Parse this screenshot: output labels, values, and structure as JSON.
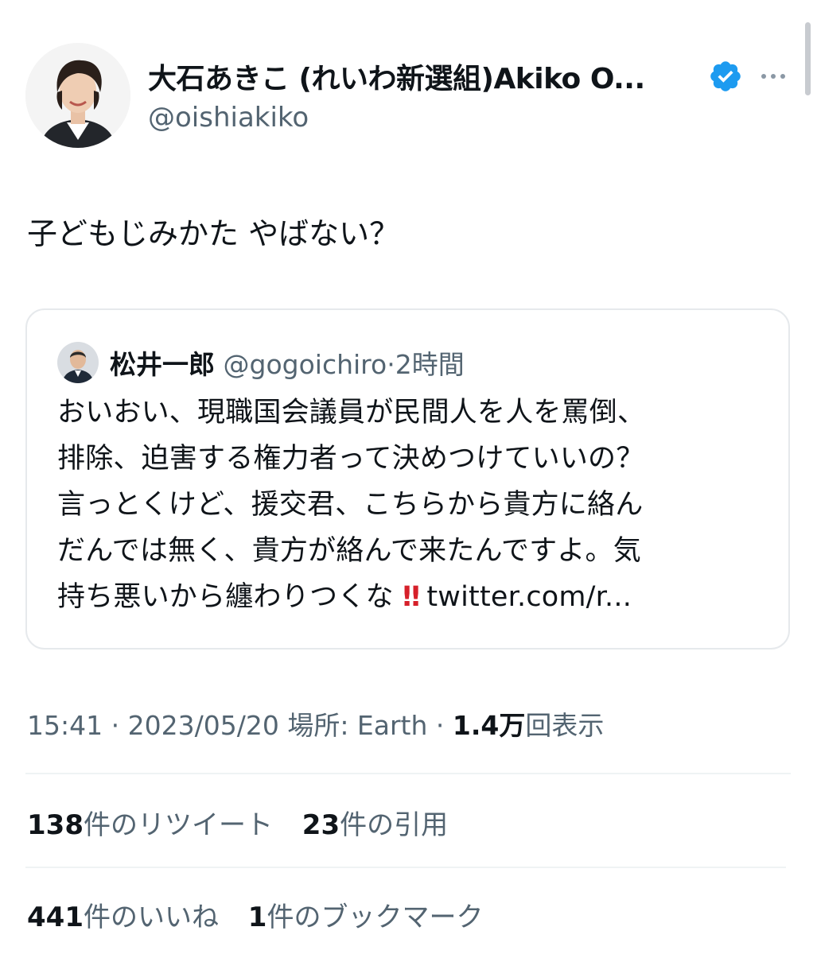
{
  "author": {
    "name": "大石あきこ (れいわ新選組)Akiko O...",
    "handle": "@oishiakiko",
    "verified_color": "#1d9bf0"
  },
  "tweet": {
    "text": "子どもじみかた やばない？"
  },
  "quote": {
    "name": "松井一郎",
    "handle": "@gogoichiro",
    "separator": "·",
    "time": "2時間",
    "lines": [
      "おいおい、現職国会議員が民間人を人を罵倒、",
      "排除、迫害する権力者って決めつけていいの？",
      "言っとくけど、援交君、こちらから貴方に絡ん",
      "だんでは無く、貴方が絡んで来たんですよ。気"
    ],
    "last_line_text": "持ち悪いから纏わりつくな",
    "alert_glyph": "‼",
    "link_text": "twitter.com/r..."
  },
  "meta": {
    "time": "15:41",
    "dot": "·",
    "date": "2023/05/20",
    "location": "場所: Earth",
    "views_count": "1.4万",
    "views_label": "回表示"
  },
  "stats": {
    "retweets": {
      "count": "138",
      "label": "件のリツイート"
    },
    "quotes": {
      "count": "23",
      "label": "件の引用"
    },
    "likes": {
      "count": "441",
      "label": "件のいいね"
    },
    "bookmarks": {
      "count": "1",
      "label": "件のブックマーク"
    }
  },
  "icons": {
    "verified": "verified-badge-icon",
    "more": "more-options-icon",
    "alert": "double-exclamation-icon"
  }
}
